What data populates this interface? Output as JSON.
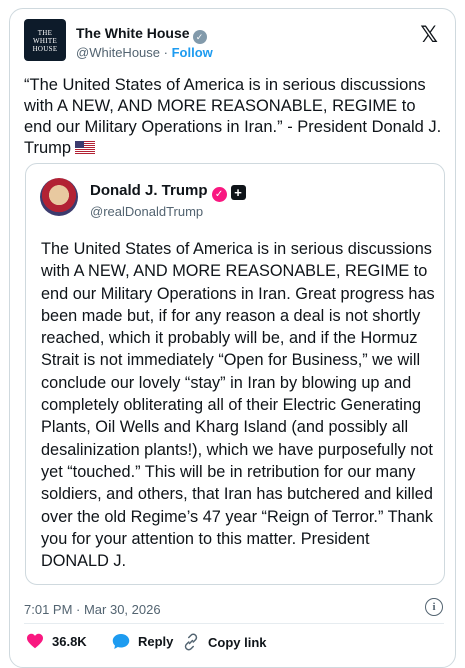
{
  "account": {
    "logo_lines": [
      "THE",
      "WHITE",
      "HOUSE"
    ],
    "name": "The White House",
    "handle": "@WhiteHouse",
    "separator": "·",
    "follow_label": "Follow"
  },
  "tweet": {
    "text": "“The United States of America is in serious discussions with A NEW, AND MORE REASONABLE, REGIME to end our Military Operations in Iran.” - President Donald J. Trump",
    "flag": "us-flag"
  },
  "quote": {
    "name": "Donald J. Trump",
    "handle": "@realDonaldTrump",
    "text": "The United States of America is in serious discussions with A NEW, AND MORE REASONABLE, REGIME to end our Military Operations in Iran. Great progress has been made but, if for any reason a deal is not shortly reached, which it probably will be, and if the Hormuz Strait is not immediately “Open for Business,” we will conclude our lovely “stay” in Iran by blowing up and completely obliterating all of their Electric Generating Plants, Oil Wells and Kharg Island (and possibly all desalinization plants!), which we have purposefully not yet “touched.” This will be in retribution for our many soldiers, and others, that Iran has butchered and killed over the old Regime’s 47 year “Reign of Terror.” Thank you for your attention to this matter. President DONALD J."
  },
  "meta": {
    "timestamp": "7:01 PM · Mar 30, 2026"
  },
  "actions": {
    "likes": "36.8K",
    "reply_label": "Reply",
    "copy_label": "Copy link"
  },
  "colors": {
    "accent": "#1d9bf0",
    "like": "#f91880",
    "verified_gray": "#829aab",
    "verified_pink": "#f91880"
  }
}
